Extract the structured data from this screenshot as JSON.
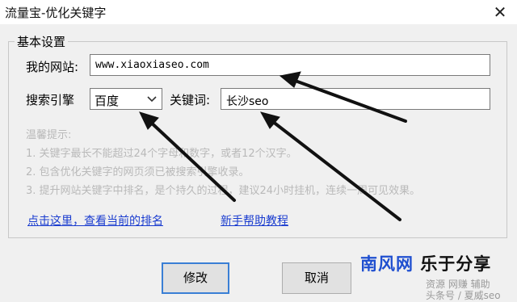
{
  "window": {
    "title": "流量宝-优化关键字",
    "close_glyph": "✕"
  },
  "group": {
    "title": "基本设置"
  },
  "fields": {
    "site_label": "我的网站:",
    "site_value": "www.xiaoxiaseo.com",
    "engine_label": "搜索引擎",
    "engine_selected": "百度",
    "keyword_label": "关键词:",
    "keyword_value": "长沙seo"
  },
  "tips": {
    "heading": "温馨提示:",
    "items": [
      "1. 关键字最长不能超过24个字母和数字，或者12个汉字。",
      "2. 包含优化关键字的网页须已被搜索引擎收录。",
      "3. 提升网站关键字中排名，是个持久的过程，建议24小时挂机，连续一周可见效果。"
    ]
  },
  "links": {
    "check_rank": "点击这里，查看当前的排名",
    "tutorial": "新手帮助教程"
  },
  "buttons": {
    "modify": "修改",
    "cancel": "取消"
  },
  "watermark": {
    "part1": "南风网",
    "part2": "乐于分享",
    "sub": "资源 网赚 辅助",
    "sub2": "头条号 / 夏威seo"
  },
  "colors": {
    "link": "#1a3ccf",
    "accent": "#3a7fd5",
    "tips": "#b9b9b9"
  },
  "icons": [
    "close-icon",
    "chevron-down-icon",
    "arrow-annotation"
  ]
}
